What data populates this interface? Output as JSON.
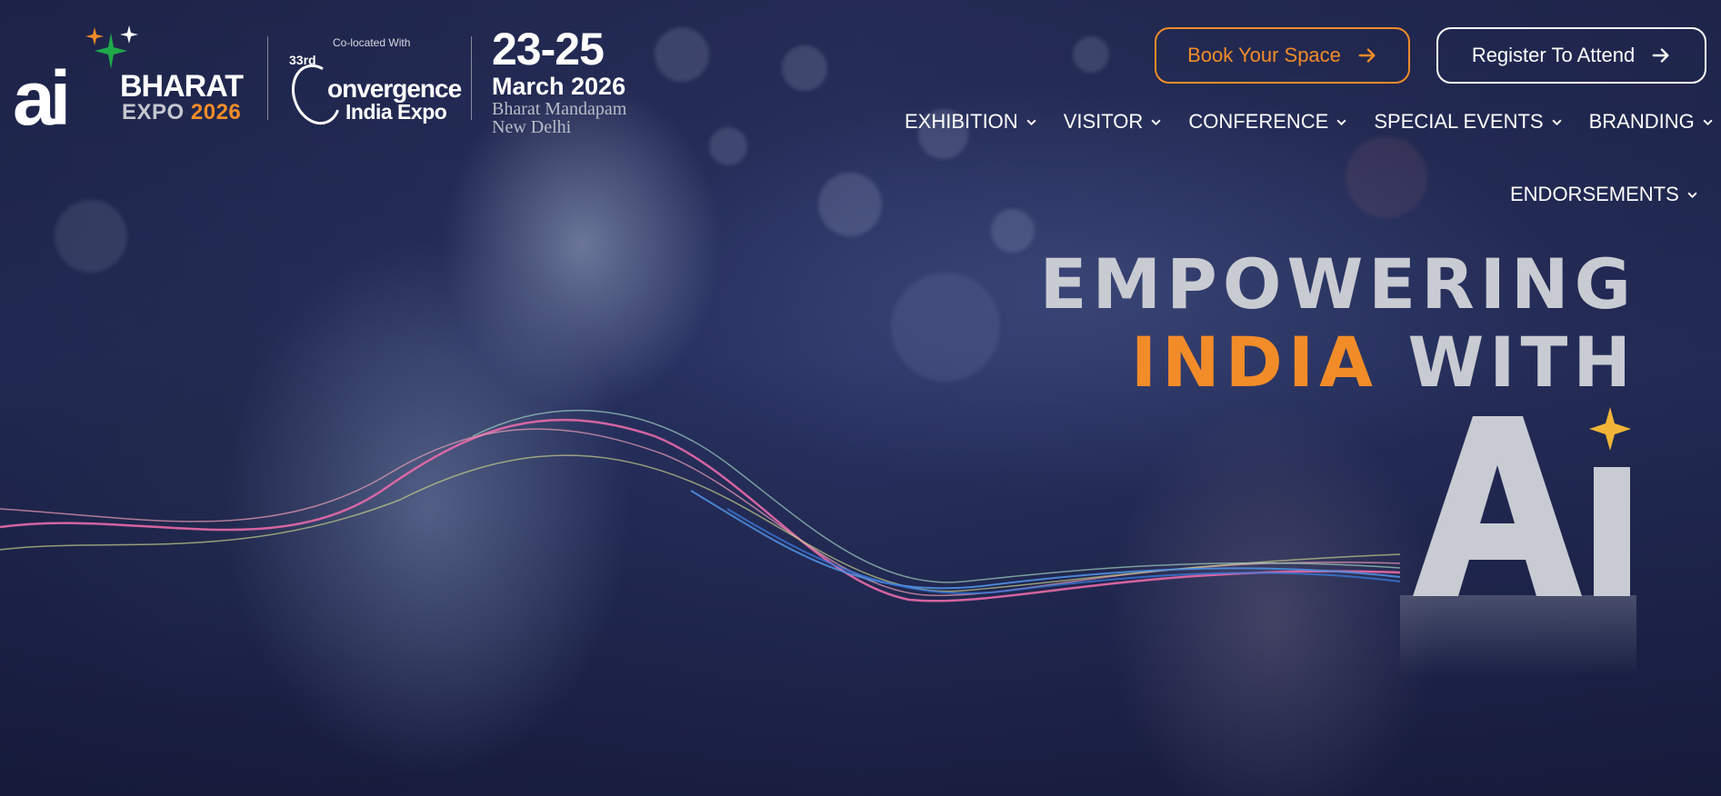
{
  "logo": {
    "ai_text": "ai",
    "bharat_text": "BHARAT",
    "expo_text": "EXPO",
    "year_text": "2026",
    "star_colors": [
      "#f28c28",
      "#1fa84a",
      "#ffffff"
    ]
  },
  "colocated": {
    "label": "Co-located With",
    "edition": "33rd",
    "title": "onvergence",
    "subtitle": "India Expo"
  },
  "event": {
    "dates": "23-25",
    "month": "March 2026",
    "venue_line1": "Bharat Mandapam",
    "venue_line2": "New Delhi"
  },
  "buttons": {
    "book_label": "Book Your Space",
    "register_label": "Register To Attend"
  },
  "nav": {
    "items": [
      {
        "label": "EXHIBITION"
      },
      {
        "label": "VISITOR"
      },
      {
        "label": "CONFERENCE"
      },
      {
        "label": "SPECIAL EVENTS"
      },
      {
        "label": "BRANDING"
      },
      {
        "label": "ENDORSEMENTS"
      }
    ]
  },
  "hero": {
    "line1": "EMPOWERING",
    "line2_highlight": "INDIA",
    "line2_rest": " WITH",
    "mark_text": "Ai"
  },
  "colors": {
    "accent_orange": "#f28c28",
    "background_navy": "#1a2140",
    "headline_grey": "#c9cbd2"
  }
}
